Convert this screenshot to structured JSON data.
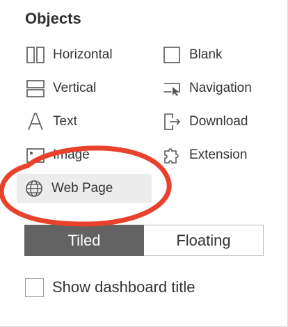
{
  "panel": {
    "title": "Objects",
    "objects": [
      {
        "label": "Horizontal",
        "icon": "horizontal-container-icon"
      },
      {
        "label": "Blank",
        "icon": "blank-icon"
      },
      {
        "label": "Vertical",
        "icon": "vertical-container-icon"
      },
      {
        "label": "Navigation",
        "icon": "navigation-icon"
      },
      {
        "label": "Text",
        "icon": "text-icon"
      },
      {
        "label": "Download",
        "icon": "download-icon"
      },
      {
        "label": "Image",
        "icon": "image-icon"
      },
      {
        "label": "Extension",
        "icon": "extension-icon"
      },
      {
        "label": "Web Page",
        "icon": "globe-icon",
        "selected": true
      }
    ],
    "layout_toggle": {
      "options": [
        "Tiled",
        "Floating"
      ],
      "selected": "Tiled"
    },
    "show_title": {
      "label": "Show dashboard title",
      "checked": false
    }
  },
  "colors": {
    "selected_toggle": "#636363",
    "annotation_ellipse": "#e8412c",
    "row_highlight": "#ececec"
  }
}
